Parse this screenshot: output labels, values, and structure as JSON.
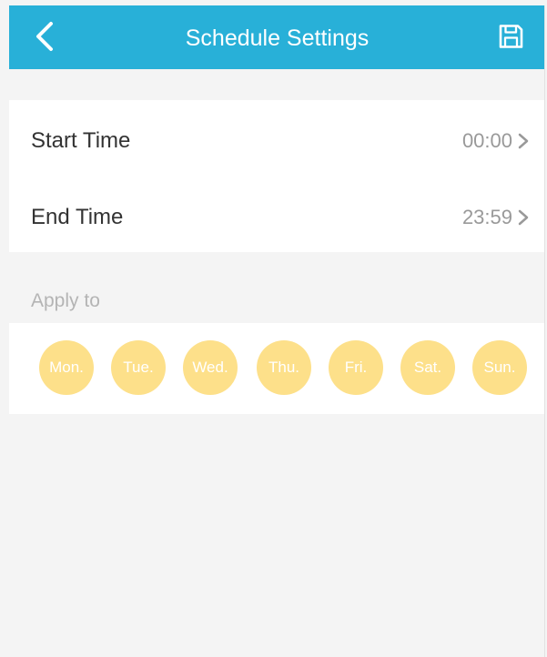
{
  "header": {
    "title": "Schedule Settings",
    "back_icon": "chevron-left-icon",
    "save_icon": "save-icon"
  },
  "schedule": {
    "start_time": {
      "label": "Start Time",
      "value": "00:00"
    },
    "end_time": {
      "label": "End Time",
      "value": "23:59"
    }
  },
  "apply_to": {
    "label": "Apply to",
    "days": [
      "Mon.",
      "Tue.",
      "Wed.",
      "Thu.",
      "Fri.",
      "Sat.",
      "Sun."
    ]
  },
  "colors": {
    "header_background": "#28b0d8",
    "day_chip": "#fde08a"
  }
}
